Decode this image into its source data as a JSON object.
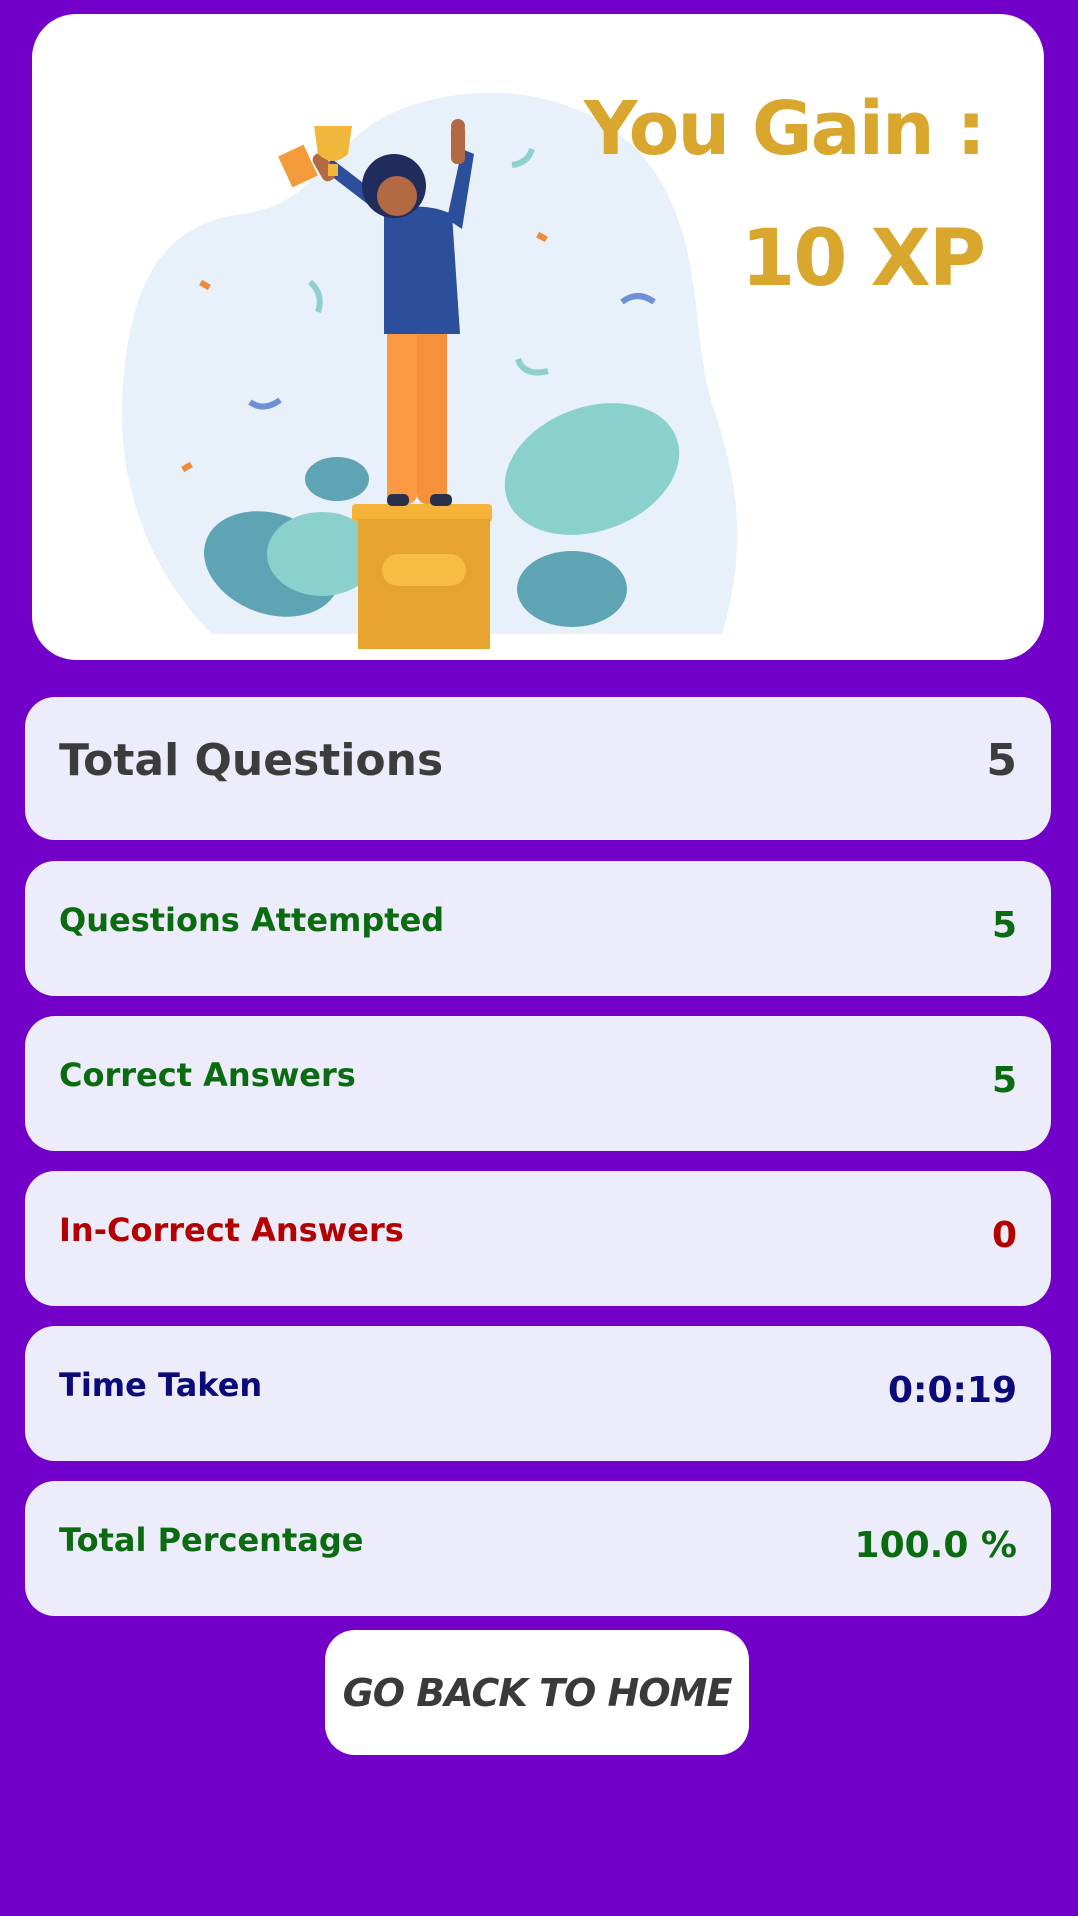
{
  "reward": {
    "title": "You Gain :",
    "xp": "10 XP"
  },
  "stats": [
    {
      "label": "Total Questions",
      "value": "5",
      "color": "#3c3c3c"
    },
    {
      "label": "Questions Attempted",
      "value": "5",
      "color": "#0a6b10"
    },
    {
      "label": "Correct Answers",
      "value": "5",
      "color": "#0a6b10"
    },
    {
      "label": "In-Correct Answers",
      "value": "0",
      "color": "#b30000"
    },
    {
      "label": "Time Taken",
      "value": "0:0:19",
      "color": "#0a0a7a"
    },
    {
      "label": "Total Percentage",
      "value": "100.0 %",
      "color": "#0a6b10"
    }
  ],
  "actions": {
    "home_label": "GO BACK TO HOME"
  },
  "colors": {
    "background": "#7200c9",
    "card": "#ececfa",
    "accent_gold": "#d9a62e"
  },
  "icons": {
    "hero": "celebration-trophy-illustration"
  }
}
